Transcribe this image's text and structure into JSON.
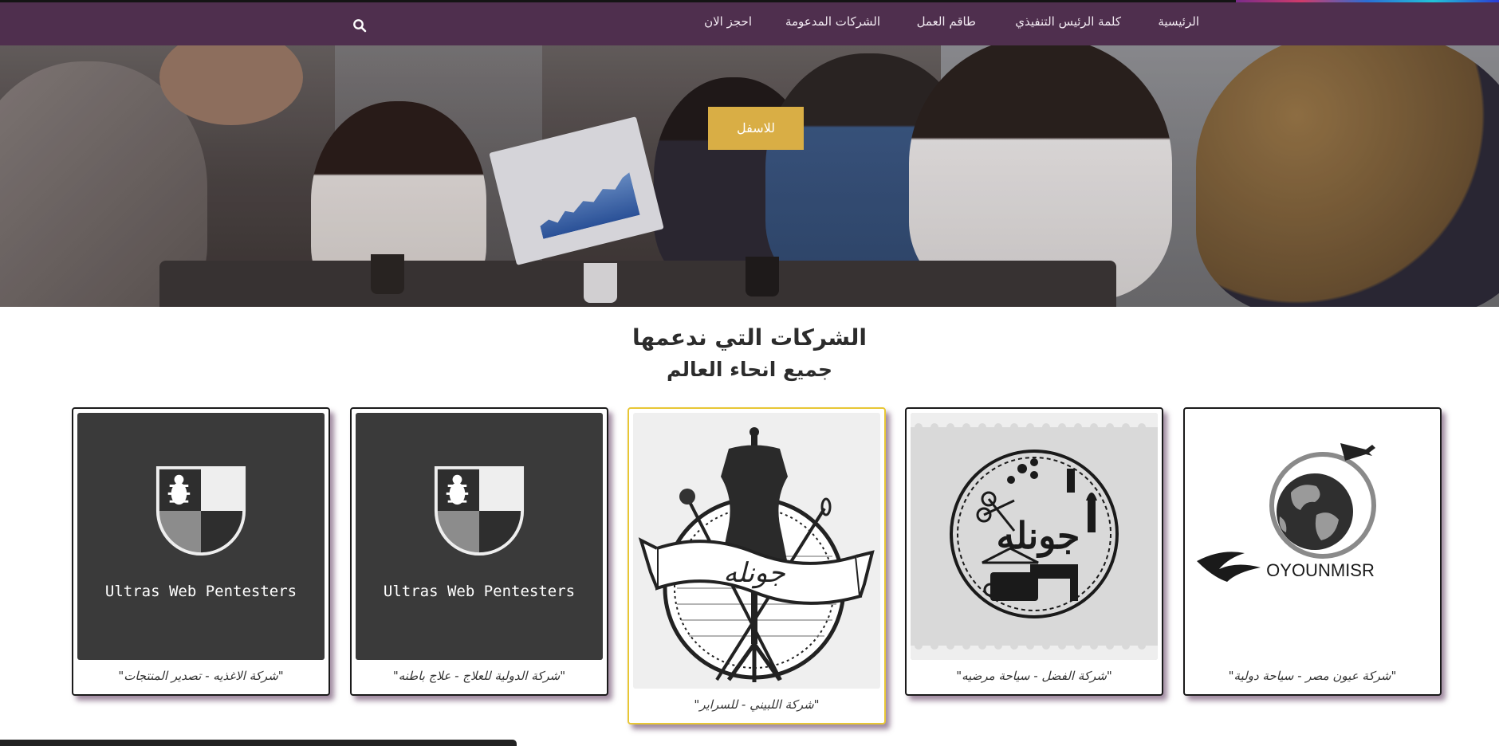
{
  "nav": {
    "items": [
      {
        "label": "الرئيسية"
      },
      {
        "label": "كلمة الرئيس التنفيذي"
      },
      {
        "label": "طاقم العمل"
      },
      {
        "label": "الشركات المدعومة"
      },
      {
        "label": "احجز الان"
      }
    ],
    "search_icon": "search-icon"
  },
  "hero": {
    "button_label": "للاسفل"
  },
  "section": {
    "title": "الشركات التي ندعمها",
    "subtitle": "جميع انحاء العالم"
  },
  "cards": [
    {
      "caption": "\"شركة الاغذيه - تصدير المنتجات\"",
      "logo_text": "Ultras Web Pentesters"
    },
    {
      "caption": "\"شركة الدولية للعلاج - علاج باطنه\"",
      "logo_text": "Ultras Web Pentesters"
    },
    {
      "caption": "\"شركة اللبيني - للسراير\"",
      "logo_text": "جونله"
    },
    {
      "caption": "\"شركة الفضل - سياحة مرضيه\"",
      "logo_text": "جونله"
    },
    {
      "caption": "\"شركة عيون مصر - سياحة دولية\"",
      "logo_text": "OYOUNMISR"
    }
  ],
  "colors": {
    "navbar": "#4f2f4e",
    "button": "#d9ae45",
    "featured_border": "#e8c735"
  }
}
